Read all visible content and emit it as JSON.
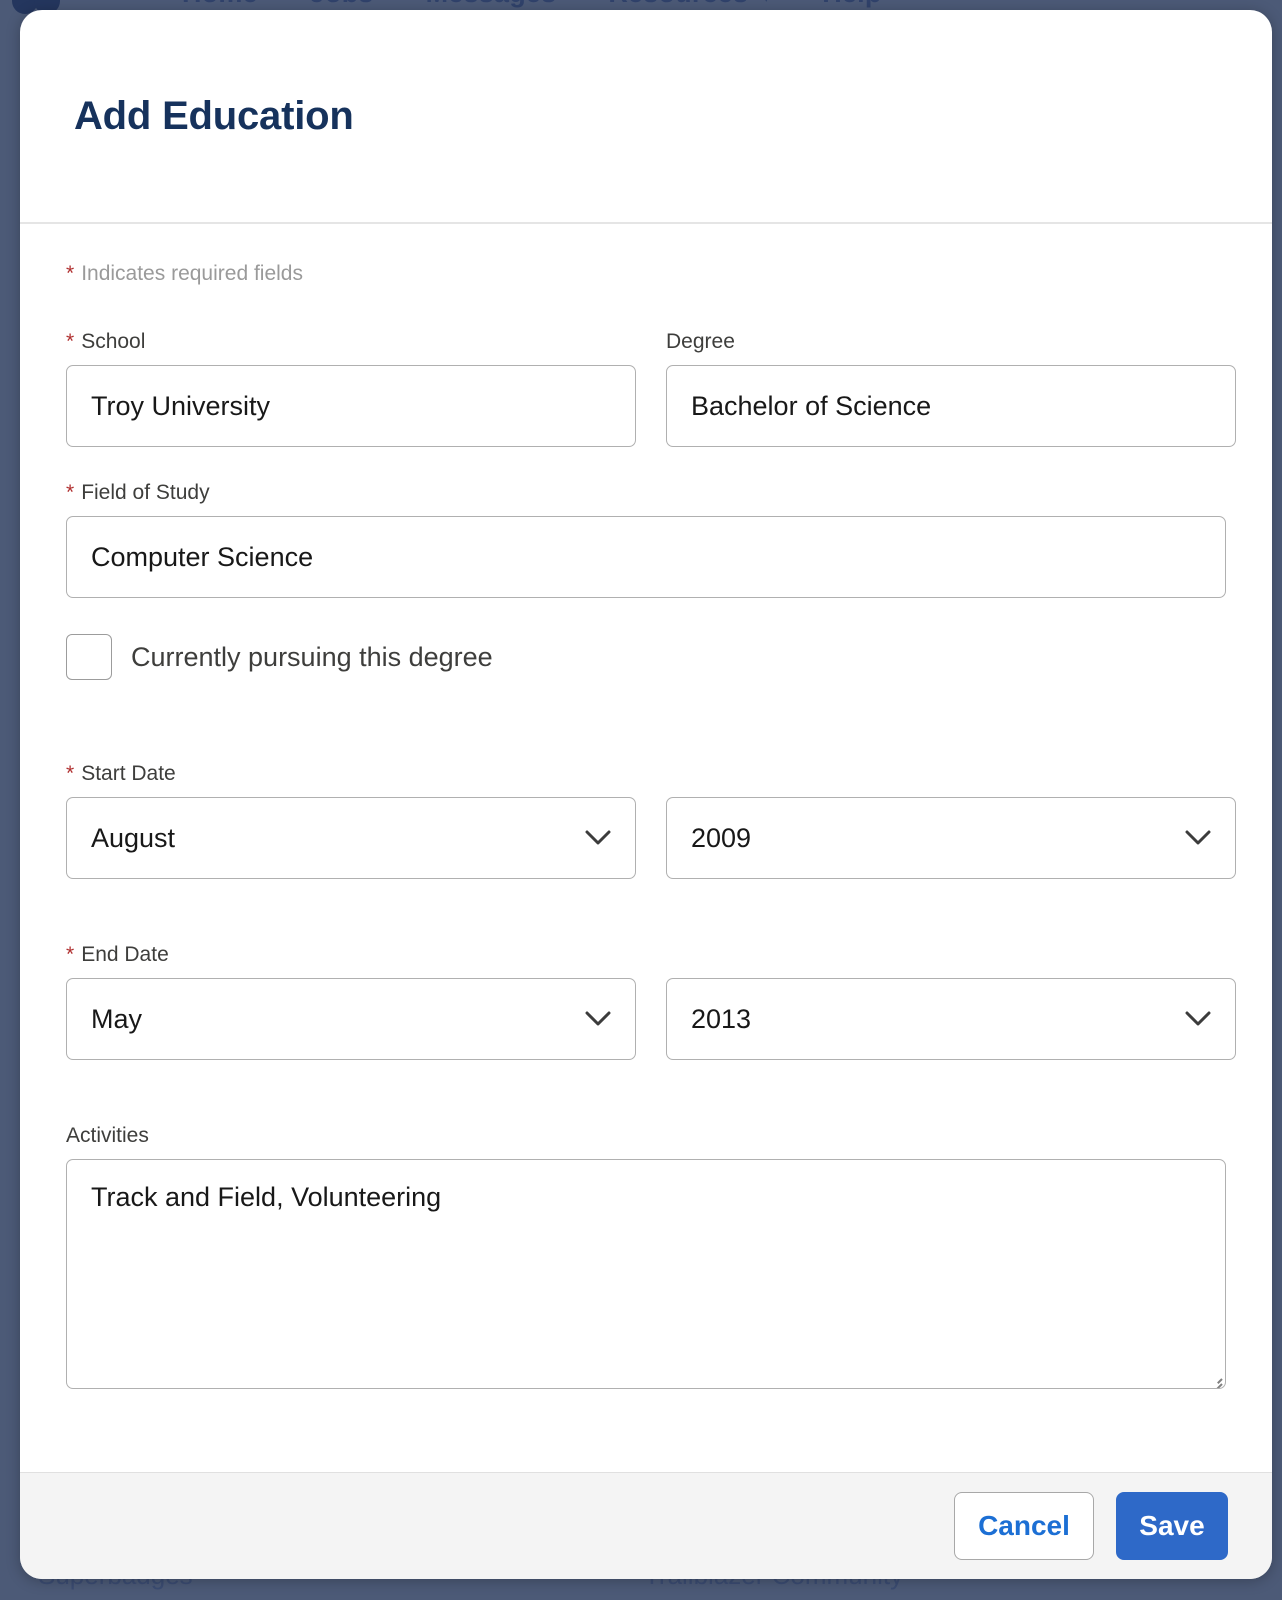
{
  "background": {
    "nav": {
      "logo_icon": "trailhead-logo-icon",
      "items": [
        {
          "label": "Home"
        },
        {
          "label": "Jobs"
        },
        {
          "label": "Messages"
        },
        {
          "label": "Resources"
        },
        {
          "label": "Help"
        }
      ],
      "caret_icon": "chevron-down-icon"
    },
    "footer": {
      "left_link": "Superbadges",
      "right_link": "Trailblazer Community"
    },
    "overlay_color": "#4c5a77"
  },
  "modal": {
    "title": "Add Education",
    "required_note": {
      "star": "*",
      "text": "Indicates required fields"
    },
    "fields": {
      "school": {
        "label": "School",
        "required_star": "*",
        "value": "Troy University"
      },
      "degree": {
        "label": "Degree",
        "value": "Bachelor of Science"
      },
      "field_of_study": {
        "label": "Field of Study",
        "required_star": "*",
        "value": "Computer Science"
      },
      "currently_pursuing": {
        "label": "Currently pursuing this degree",
        "checked": false
      },
      "start_date": {
        "label": "Start Date",
        "required_star": "*",
        "month": "August",
        "year": "2009"
      },
      "end_date": {
        "label": "End Date",
        "required_star": "*",
        "month": "May",
        "year": "2013"
      },
      "activities": {
        "label": "Activities",
        "value": "Track and Field, Volunteering"
      }
    },
    "footer": {
      "cancel_label": "Cancel",
      "save_label": "Save"
    },
    "colors": {
      "title": "#16325c",
      "required_star": "#b03030",
      "save_bg": "#2e69c8",
      "cancel_text": "#1c6fd4"
    }
  }
}
